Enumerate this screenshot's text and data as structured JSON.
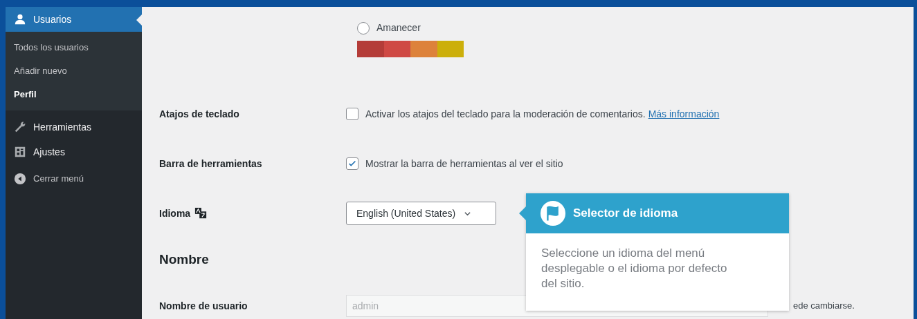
{
  "sidebar": {
    "menu": [
      {
        "label": "Usuarios",
        "selected": true,
        "children": [
          {
            "label": "Todos los usuarios",
            "selected": false
          },
          {
            "label": "Añadir nuevo",
            "selected": false
          },
          {
            "label": "Perfil",
            "selected": true
          }
        ]
      },
      {
        "label": "Herramientas",
        "selected": false
      },
      {
        "label": "Ajustes",
        "selected": false
      }
    ],
    "collapse": {
      "label": "Cerrar menú"
    }
  },
  "color_scheme": {
    "label": "Amanecer",
    "selected": false,
    "swatches": [
      {
        "color": "#b43c38"
      },
      {
        "color": "#cf4944"
      },
      {
        "color": "#dd823b"
      },
      {
        "color": "#ccaf0b"
      }
    ]
  },
  "settings": [
    {
      "kind": "checkbox",
      "label": "Atajos de teclado",
      "text": "Activar los atajos del teclado para la moderación de comentarios.",
      "link": "Más información",
      "checked": false
    },
    {
      "kind": "checkbox",
      "label": "Barra de herramientas",
      "text": "Mostrar la barra de herramientas al ver el sitio",
      "checked": true
    },
    {
      "kind": "select",
      "label": "Idioma",
      "value": "English (United States)"
    },
    {
      "kind": "heading",
      "label": "Nombre"
    },
    {
      "kind": "input",
      "label": "Nombre de usuario",
      "value": "admin",
      "disabled": true,
      "description": "ede cambiarse."
    }
  ],
  "tooltip": {
    "title": "Selector de idioma",
    "body": "Seleccione un idioma del menú desplegable o el idioma por defecto del sitio."
  }
}
